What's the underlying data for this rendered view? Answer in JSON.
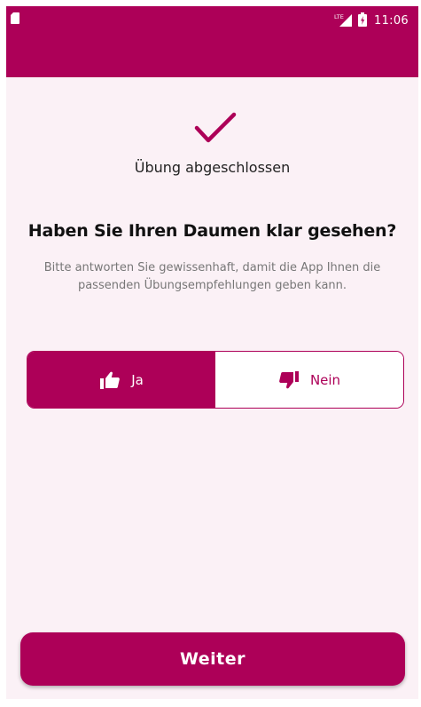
{
  "status_bar": {
    "network": "LTE",
    "time": "11:06"
  },
  "main": {
    "done_text": "Übung abgeschlossen",
    "question": "Haben Sie Ihren Daumen klar gesehen?",
    "hint": "Bitte antworten Sie gewissenhaft, damit die App Ihnen die passenden Übungsempfehlungen geben kann."
  },
  "toggle": {
    "yes_label": "Ja",
    "no_label": "Nein",
    "selected": "Ja"
  },
  "footer": {
    "next_label": "Weiter"
  },
  "icons": {
    "check": "checkmark-icon",
    "yes": "thumbs-up-icon",
    "no": "thumbs-down-icon",
    "sd": "sd-card-icon",
    "signal": "lte-signal-icon",
    "battery": "battery-charging-icon"
  },
  "colors": {
    "primary": "#ad0058",
    "background": "#fbf1f6",
    "text": "#111111",
    "muted": "#777777"
  }
}
